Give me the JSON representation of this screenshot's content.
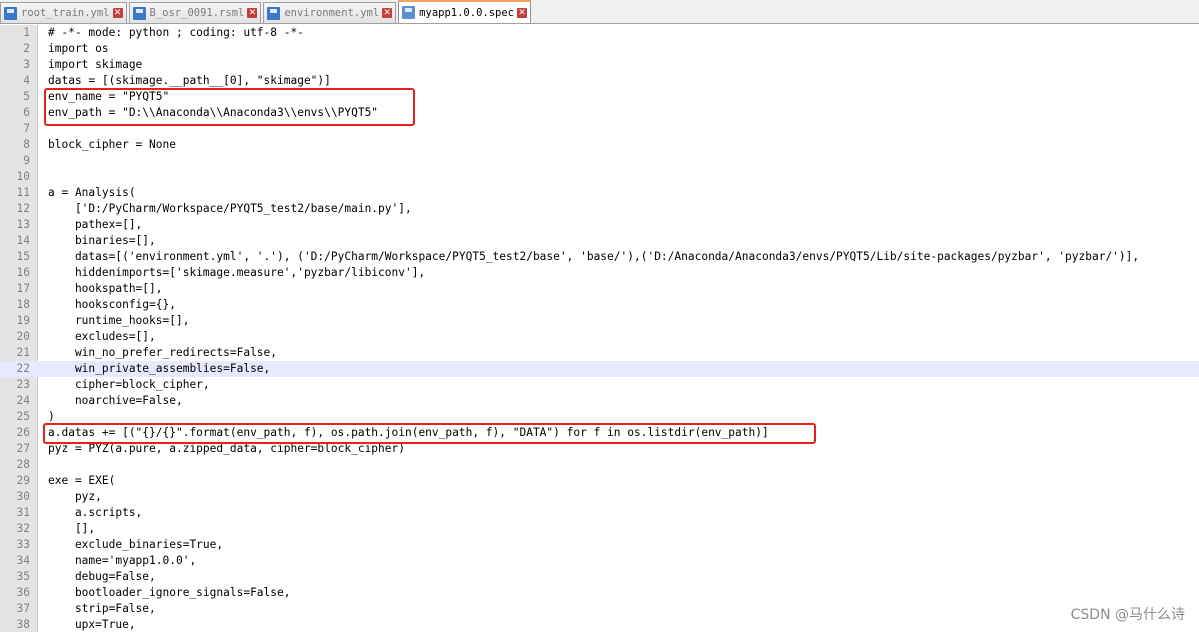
{
  "tabs": [
    {
      "label": "root_train.yml",
      "active": false
    },
    {
      "label": "B_osr_0091.rsml",
      "active": false
    },
    {
      "label": "environment.yml",
      "active": false
    },
    {
      "label": "myapp1.0.0.spec",
      "active": true
    }
  ],
  "editor": {
    "current_line": 22,
    "lines": [
      {
        "n": "1",
        "text": "# -*- mode: python ; coding: utf-8 -*-"
      },
      {
        "n": "2",
        "text": "import os"
      },
      {
        "n": "3",
        "text": "import skimage"
      },
      {
        "n": "4",
        "text": "datas = [(skimage.__path__[0], \"skimage\")]"
      },
      {
        "n": "5",
        "text": "env_name = \"PYQT5\""
      },
      {
        "n": "6",
        "text": "env_path = \"D:\\\\Anaconda\\\\Anaconda3\\\\envs\\\\PYQT5\""
      },
      {
        "n": "7",
        "text": ""
      },
      {
        "n": "8",
        "text": "block_cipher = None"
      },
      {
        "n": "9",
        "text": ""
      },
      {
        "n": "10",
        "text": ""
      },
      {
        "n": "11",
        "text": "a = Analysis("
      },
      {
        "n": "12",
        "text": "    ['D:/PyCharm/Workspace/PYQT5_test2/base/main.py'],"
      },
      {
        "n": "13",
        "text": "    pathex=[],"
      },
      {
        "n": "14",
        "text": "    binaries=[],"
      },
      {
        "n": "15",
        "text": "    datas=[('environment.yml', '.'), ('D:/PyCharm/Workspace/PYQT5_test2/base', 'base/'),('D:/Anaconda/Anaconda3/envs/PYQT5/Lib/site-packages/pyzbar', 'pyzbar/')],"
      },
      {
        "n": "16",
        "text": "    hiddenimports=['skimage.measure','pyzbar/libiconv'],"
      },
      {
        "n": "17",
        "text": "    hookspath=[],"
      },
      {
        "n": "18",
        "text": "    hooksconfig={},"
      },
      {
        "n": "19",
        "text": "    runtime_hooks=[],"
      },
      {
        "n": "20",
        "text": "    excludes=[],"
      },
      {
        "n": "21",
        "text": "    win_no_prefer_redirects=False,"
      },
      {
        "n": "22",
        "text": "    win_private_assemblies=False,"
      },
      {
        "n": "23",
        "text": "    cipher=block_cipher,"
      },
      {
        "n": "24",
        "text": "    noarchive=False,"
      },
      {
        "n": "25",
        "text": ")"
      },
      {
        "n": "26",
        "text": "a.datas += [(\"{}/{}\".format(env_path, f), os.path.join(env_path, f), \"DATA\") for f in os.listdir(env_path)]"
      },
      {
        "n": "27",
        "text": "pyz = PYZ(a.pure, a.zipped_data, cipher=block_cipher)"
      },
      {
        "n": "28",
        "text": ""
      },
      {
        "n": "29",
        "text": "exe = EXE("
      },
      {
        "n": "30",
        "text": "    pyz,"
      },
      {
        "n": "31",
        "text": "    a.scripts,"
      },
      {
        "n": "32",
        "text": "    [],"
      },
      {
        "n": "33",
        "text": "    exclude_binaries=True,"
      },
      {
        "n": "34",
        "text": "    name='myapp1.0.0',"
      },
      {
        "n": "35",
        "text": "    debug=False,"
      },
      {
        "n": "36",
        "text": "    bootloader_ignore_signals=False,"
      },
      {
        "n": "37",
        "text": "    strip=False,"
      },
      {
        "n": "38",
        "text": "    upx=True,"
      }
    ]
  },
  "watermark": "CSDN @马什么诗",
  "colors": {
    "annotation_box": "#e8221b",
    "tab_close": "#c4413a",
    "file_icon": "#3a78c9"
  }
}
